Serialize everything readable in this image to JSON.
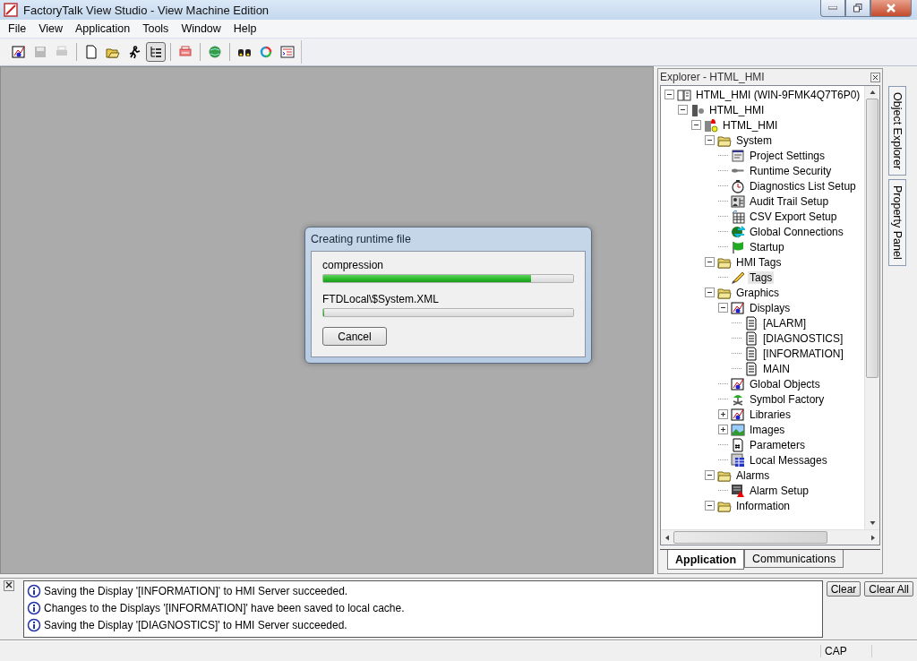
{
  "window": {
    "title": "FactoryTalk View Studio - View Machine Edition"
  },
  "menu": [
    "File",
    "View",
    "Application",
    "Tools",
    "Window",
    "Help"
  ],
  "toolbar": [
    {
      "kind": "editor",
      "disabled": false,
      "pressed": false
    },
    {
      "kind": "save",
      "disabled": true,
      "pressed": false
    },
    {
      "kind": "print",
      "disabled": true,
      "pressed": false
    },
    {
      "kind": "separator"
    },
    {
      "kind": "new",
      "disabled": false,
      "pressed": false
    },
    {
      "kind": "open",
      "disabled": false,
      "pressed": false
    },
    {
      "kind": "run",
      "disabled": false,
      "pressed": false
    },
    {
      "kind": "explorer",
      "disabled": false,
      "pressed": true
    },
    {
      "kind": "separator"
    },
    {
      "kind": "transfer",
      "disabled": false,
      "pressed": false
    },
    {
      "kind": "separator"
    },
    {
      "kind": "web",
      "disabled": false,
      "pressed": false
    },
    {
      "kind": "separator"
    },
    {
      "kind": "find",
      "disabled": false,
      "pressed": false
    },
    {
      "kind": "refresh",
      "disabled": false,
      "pressed": false
    },
    {
      "kind": "log",
      "disabled": false,
      "pressed": false
    }
  ],
  "dialog": {
    "title": "Creating runtime file",
    "tasks": [
      {
        "label": "compression",
        "level": 0.83
      },
      {
        "label": "FTDLocal\\$System.XML",
        "level": 0
      }
    ],
    "button": "Cancel"
  },
  "explorer": {
    "title": "Explorer - HTML_HMI",
    "tree": [
      {
        "label": "HTML_HMI (WIN-9FMK4Q7T6P0)",
        "kind": "project",
        "expanded": true,
        "selected": false,
        "children": [
          {
            "label": "HTML_HMI",
            "kind": "server",
            "expanded": true,
            "selected": false,
            "children": [
              {
                "label": "HTML_HMI",
                "kind": "application",
                "expanded": true,
                "selected": false,
                "children": [
                  {
                    "label": "System",
                    "kind": "folder",
                    "expanded": true,
                    "selected": false,
                    "children": [
                      {
                        "label": "Project Settings",
                        "kind": "settings",
                        "selected": false
                      },
                      {
                        "label": "Runtime Security",
                        "kind": "security",
                        "selected": false
                      },
                      {
                        "label": "Diagnostics List Setup",
                        "kind": "diagnostics",
                        "selected": false
                      },
                      {
                        "label": "Audit Trail Setup",
                        "kind": "audit",
                        "selected": false
                      },
                      {
                        "label": "CSV Export Setup",
                        "kind": "export",
                        "selected": false
                      },
                      {
                        "label": "Global Connections",
                        "kind": "connections",
                        "selected": false
                      },
                      {
                        "label": "Startup",
                        "kind": "startup",
                        "selected": false
                      }
                    ]
                  },
                  {
                    "label": "HMI Tags",
                    "kind": "folder",
                    "expanded": true,
                    "selected": false,
                    "children": [
                      {
                        "label": "Tags",
                        "kind": "tags",
                        "selected": true
                      }
                    ]
                  },
                  {
                    "label": "Graphics",
                    "kind": "folder",
                    "expanded": true,
                    "selected": false,
                    "children": [
                      {
                        "label": "Displays",
                        "kind": "editor",
                        "expanded": true,
                        "selected": false,
                        "children": [
                          {
                            "label": "[ALARM]",
                            "kind": "display",
                            "selected": false
                          },
                          {
                            "label": "[DIAGNOSTICS]",
                            "kind": "display",
                            "selected": false
                          },
                          {
                            "label": "[INFORMATION]",
                            "kind": "display",
                            "selected": false
                          },
                          {
                            "label": "MAIN",
                            "kind": "display",
                            "selected": false
                          }
                        ]
                      },
                      {
                        "label": "Global Objects",
                        "kind": "editor",
                        "selected": false
                      },
                      {
                        "label": "Symbol Factory",
                        "kind": "symbols",
                        "selected": false
                      },
                      {
                        "label": "Libraries",
                        "kind": "editor",
                        "expanded": false,
                        "selected": false
                      },
                      {
                        "label": "Images",
                        "kind": "images",
                        "expanded": false,
                        "selected": false
                      },
                      {
                        "label": "Parameters",
                        "kind": "parameters",
                        "selected": false
                      },
                      {
                        "label": "Local Messages",
                        "kind": "messages",
                        "selected": false
                      }
                    ]
                  },
                  {
                    "label": "Alarms",
                    "kind": "folder",
                    "expanded": true,
                    "selected": false,
                    "children": [
                      {
                        "label": "Alarm Setup",
                        "kind": "alarm",
                        "selected": false
                      }
                    ]
                  },
                  {
                    "label": "Information",
                    "kind": "folder",
                    "expanded": true,
                    "selected": false
                  }
                ]
              }
            ]
          }
        ]
      }
    ],
    "tabs": [
      {
        "label": "Application",
        "selected": true
      },
      {
        "label": "Communications",
        "selected": false
      }
    ]
  },
  "side_tabs": [
    "Object Explorer",
    "Property Panel"
  ],
  "messages": [
    "Saving the Display '[INFORMATION]' to HMI Server succeeded.",
    "Changes to the Displays '[INFORMATION]' have been saved to local cache.",
    "Saving the Display '[DIAGNOSTICS]' to HMI Server succeeded."
  ],
  "message_buttons": [
    "Clear",
    "Clear All"
  ],
  "status_bar": {
    "indicator": "CAP"
  }
}
